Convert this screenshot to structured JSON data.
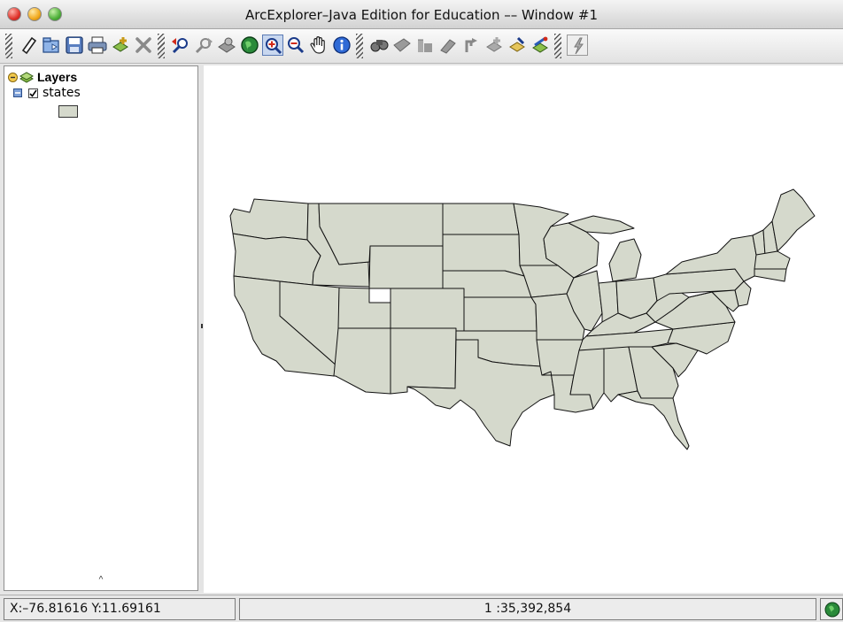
{
  "window": {
    "title": "ArcExplorer–Java Edition for Education –– Window #1"
  },
  "toolbar": {
    "tools": [
      {
        "name": "new-icon"
      },
      {
        "name": "open-icon"
      },
      {
        "name": "save-icon"
      },
      {
        "name": "print-icon"
      },
      {
        "name": "add-layer-icon"
      },
      {
        "name": "delete-layer-icon"
      },
      {
        "name": "zoom-previous-icon"
      },
      {
        "name": "zoom-next-icon"
      },
      {
        "name": "zoom-active-layer-icon"
      },
      {
        "name": "full-extent-icon"
      },
      {
        "name": "zoom-in-icon",
        "pressed": true
      },
      {
        "name": "zoom-out-icon"
      },
      {
        "name": "pan-icon"
      },
      {
        "name": "identify-icon"
      },
      {
        "name": "find-icon"
      },
      {
        "name": "query-icon"
      },
      {
        "name": "select-icon"
      },
      {
        "name": "clear-selection-icon"
      },
      {
        "name": "measure-icon"
      },
      {
        "name": "buffer-icon"
      },
      {
        "name": "label-icon"
      },
      {
        "name": "thematic-icon"
      },
      {
        "name": "hotlink-icon"
      }
    ]
  },
  "layers_panel": {
    "title": "Layers",
    "layers": [
      {
        "name": "states",
        "visible": true,
        "fill_color": "#d5d9cc"
      }
    ]
  },
  "map": {
    "fill_color": "#d5d9cc",
    "outline_color": "#111111",
    "background": "#ffffff"
  },
  "status": {
    "coordinates": "X:–76.81616 Y:11.69161",
    "scale": "1 :35,392,854"
  }
}
